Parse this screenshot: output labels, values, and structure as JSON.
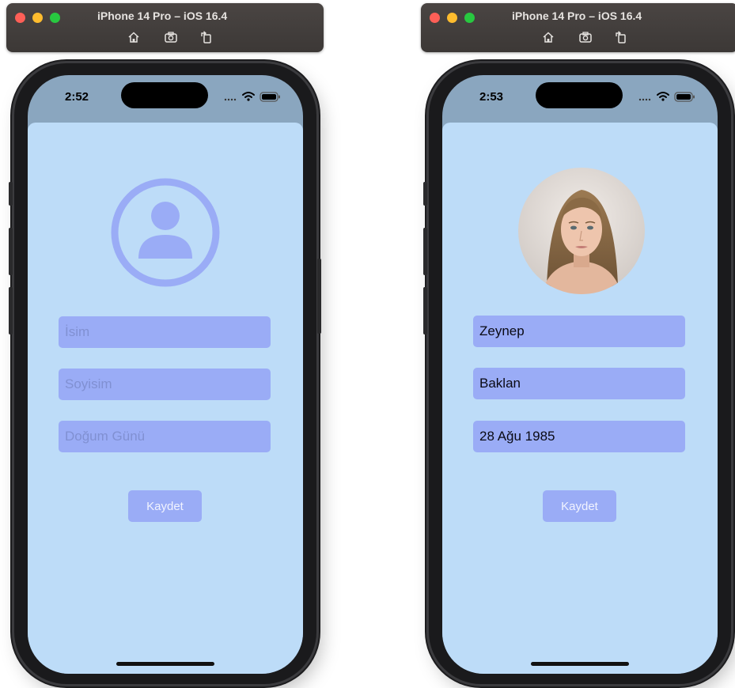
{
  "simulators": [
    {
      "window_title": "iPhone 14 Pro – iOS 16.4",
      "toolbar_icons": [
        "home-icon",
        "screenshot-icon",
        "rotate-icon"
      ],
      "status_time": "2:52",
      "status_icons": [
        "signal-icon",
        "wifi-icon",
        "battery-icon"
      ],
      "avatar": "person-placeholder-icon",
      "fields": [
        {
          "value": "",
          "placeholder": "İsim",
          "shown": "İsim"
        },
        {
          "value": "",
          "placeholder": "Soyisim",
          "shown": "Soyisim"
        },
        {
          "value": "",
          "placeholder": "Doğum Günü",
          "shown": "Doğum Günü"
        }
      ],
      "save_label": "Kaydet"
    },
    {
      "window_title": "iPhone 14 Pro – iOS 16.4",
      "toolbar_icons": [
        "home-icon",
        "screenshot-icon",
        "rotate-icon"
      ],
      "status_time": "2:53",
      "status_icons": [
        "signal-icon",
        "wifi-icon",
        "battery-icon"
      ],
      "avatar": "profile-photo",
      "fields": [
        {
          "value": "Zeynep",
          "placeholder": "İsim",
          "shown": "Zeynep"
        },
        {
          "value": "Baklan",
          "placeholder": "Soyisim",
          "shown": "Baklan"
        },
        {
          "value": "28 Ağu 1985",
          "placeholder": "Doğum Günü",
          "shown": "28 Ağu 1985"
        }
      ],
      "save_label": "Kaydet"
    }
  ],
  "colors": {
    "sheet_background": "#bddcf8",
    "field_background": "#9aacf6",
    "placeholder_text": "#8090d2",
    "status_area": "#8aa6bf"
  }
}
